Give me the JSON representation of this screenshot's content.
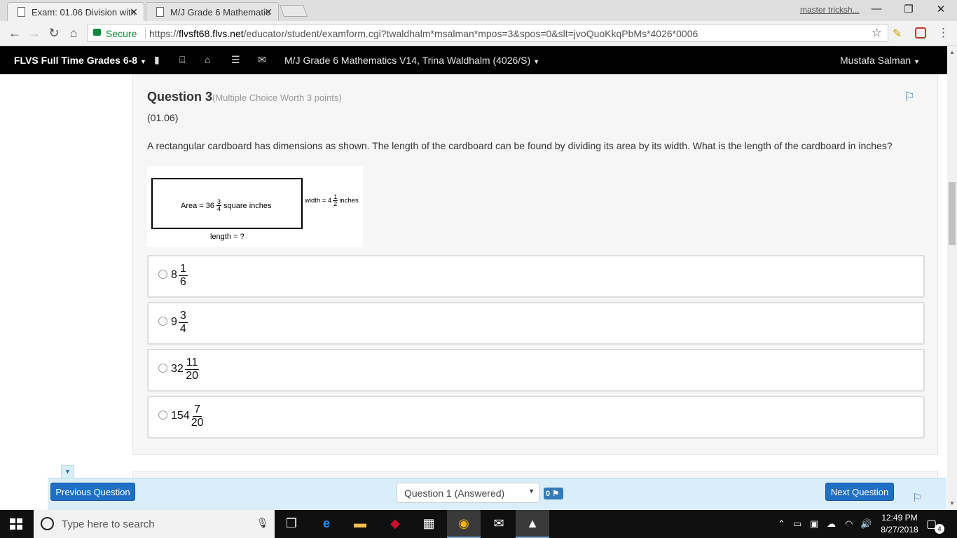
{
  "browser": {
    "tabs": [
      {
        "title": "Exam: 01.06 Division with",
        "close": "✕"
      },
      {
        "title": "M/J Grade 6 Mathematic",
        "close": "✕"
      }
    ],
    "profile": "master tricksh...",
    "window_controls": {
      "minimize": "—",
      "maximize": "❐",
      "close": "✕"
    },
    "secure_label": "Secure",
    "url_prefix": "https://",
    "url_host": "flvsft68.flvs.net",
    "url_path": "/educator/student/examform.cgi?twaldhalm*msalman*mpos=3&spos=0&slt=jvoQuoKkqPbMs*4026*0006"
  },
  "sitenav": {
    "brand": "FLVS Full Time Grades 6-8",
    "course": "M/J Grade 6 Mathematics V14, Trina Waldhalm (4026/S)",
    "user": "Mustafa Salman"
  },
  "question": {
    "title": "Question 3",
    "worth": "(Multiple Choice Worth 3 points)",
    "code": "(01.06)",
    "text": "A rectangular cardboard has dimensions as shown. The length of the cardboard can be found by dividing its area by its width. What is the length of the cardboard in inches?",
    "figure": {
      "area_prefix": "Area  =  36",
      "area_num": "3",
      "area_den": "4",
      "area_suffix": "square inches",
      "width_prefix": "width = 4",
      "width_num": "1",
      "width_den": "2",
      "width_suffix": "inches",
      "length_label": "length = ?"
    },
    "choices": [
      {
        "whole": "8",
        "num": "1",
        "den": "6"
      },
      {
        "whole": "9",
        "num": "3",
        "den": "4"
      },
      {
        "whole": "32",
        "num": "11",
        "den": "20"
      },
      {
        "whole": "154",
        "num": "7",
        "den": "20"
      }
    ]
  },
  "bottombar": {
    "prev": "Previous Question",
    "next": "Next Question",
    "select_value": "Question 1 (Answered)",
    "flag_count": "0"
  },
  "taskbar": {
    "search_placeholder": "Type here to search",
    "time": "12:49 PM",
    "date": "8/27/2018",
    "notifications": "4"
  },
  "colors": {
    "accent": "#1f6fc4",
    "nav_bg": "#000000",
    "secure": "#0a8a3a"
  }
}
